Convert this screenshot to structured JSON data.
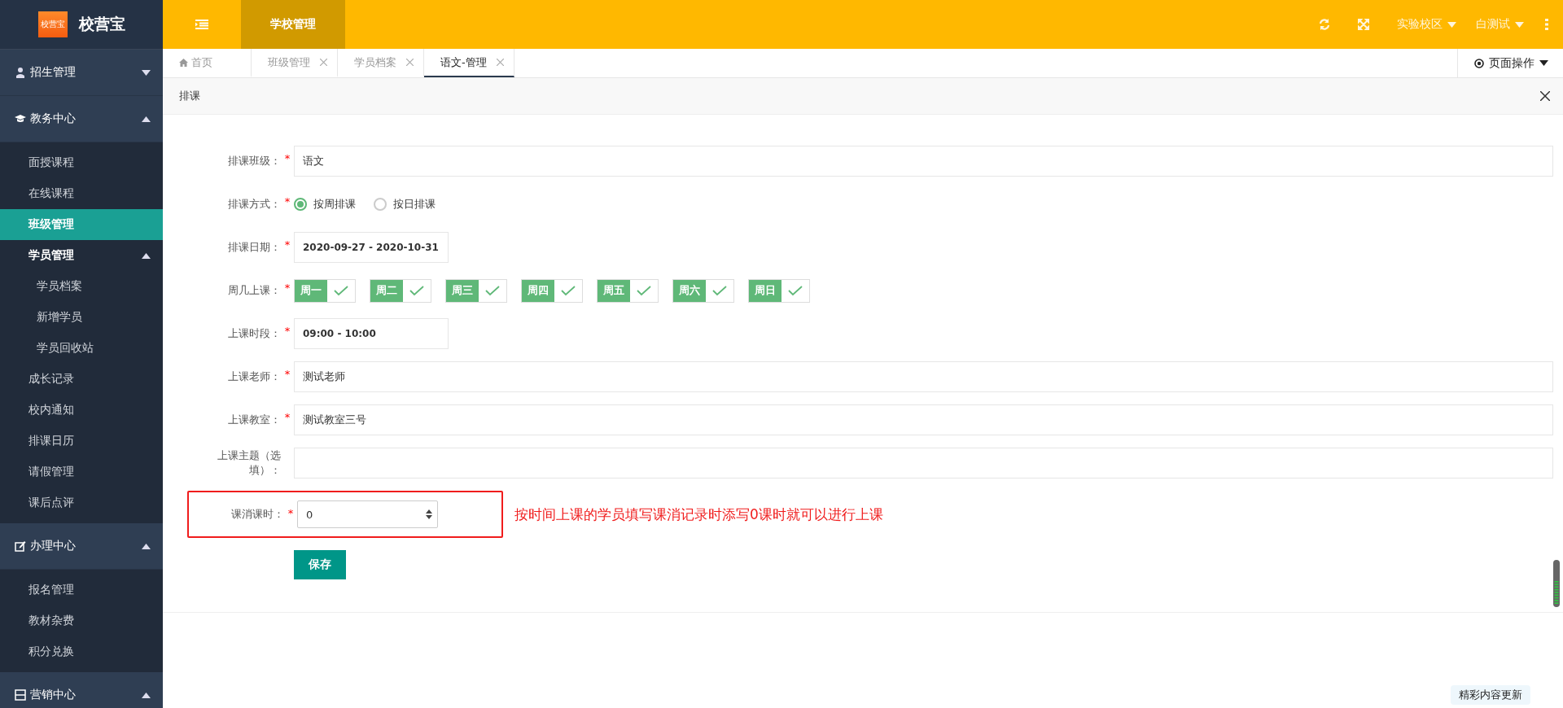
{
  "sidebar": {
    "logo_text": "校营宝",
    "brand": "校营宝",
    "groups": [
      {
        "label": "招生管理",
        "expanded": false
      },
      {
        "label": "教务中心",
        "expanded": true,
        "items": [
          {
            "label": "面授课程",
            "selected": false
          },
          {
            "label": "在线课程",
            "selected": false
          },
          {
            "label": "班级管理",
            "selected": true
          },
          {
            "label": "学员管理",
            "selected": false,
            "expanded": true,
            "children": [
              {
                "label": "学员档案",
                "selected": false
              },
              {
                "label": "新增学员",
                "selected": false
              },
              {
                "label": "学员回收站",
                "selected": false
              }
            ]
          },
          {
            "label": "成长记录",
            "selected": false
          },
          {
            "label": "校内通知",
            "selected": false
          },
          {
            "label": "排课日历",
            "selected": false
          },
          {
            "label": "请假管理",
            "selected": false
          },
          {
            "label": "课后点评",
            "selected": false
          }
        ]
      },
      {
        "label": "办理中心",
        "expanded": true,
        "items": [
          {
            "label": "报名管理",
            "selected": false
          },
          {
            "label": "教材杂费",
            "selected": false
          },
          {
            "label": "积分兑换",
            "selected": false
          }
        ]
      },
      {
        "label": "营销中心",
        "expanded": true
      }
    ]
  },
  "top_bar": {
    "nav": [
      {
        "label": "学校管理",
        "selected": true
      }
    ],
    "campus": "实验校区",
    "user": "白测试"
  },
  "tabs": [
    {
      "label": "首页",
      "kind": "home",
      "selected": false
    },
    {
      "label": "班级管理",
      "kind": "closable",
      "selected": false
    },
    {
      "label": "学员档案",
      "kind": "closable",
      "selected": false
    },
    {
      "label": "语文-管理",
      "kind": "closable",
      "selected": true
    }
  ],
  "page_actions": "页面操作",
  "panel": {
    "title": "排课",
    "fields": [
      {
        "kind": "text",
        "label": "排课班级：",
        "required_mark": "*",
        "value": "语文"
      },
      {
        "kind": "radio",
        "label": "排课方式：",
        "required_mark": "*",
        "options": [
          {
            "label": "按周排课",
            "selected": true
          },
          {
            "label": "按日排课",
            "selected": false
          }
        ]
      },
      {
        "kind": "short",
        "label": "排课日期：",
        "required_mark": "*",
        "value": "2020-09-27 - 2020-10-31"
      },
      {
        "kind": "weekdays",
        "label": "周几上课：",
        "required_mark": "*",
        "days": [
          {
            "label": "周一",
            "checked": true
          },
          {
            "label": "周二",
            "checked": true
          },
          {
            "label": "周三",
            "checked": true
          },
          {
            "label": "周四",
            "checked": true
          },
          {
            "label": "周五",
            "checked": true
          },
          {
            "label": "周六",
            "checked": true
          },
          {
            "label": "周日",
            "checked": true
          }
        ]
      },
      {
        "kind": "short",
        "label": "上课时段：",
        "required_mark": "*",
        "value": "09:00 - 10:00"
      },
      {
        "kind": "text",
        "label": "上课老师：",
        "required_mark": "*",
        "value": "测试老师"
      },
      {
        "kind": "text",
        "label": "上课教室：",
        "required_mark": "*",
        "value": "测试教室三号"
      },
      {
        "kind": "text",
        "label": "上课主题（选填）："
      },
      {
        "kind": "number",
        "label": "课消课时：",
        "required_mark": "*",
        "value": "0",
        "highlighted": true,
        "annotation": "按时间上课的学员填写课消记录时添写0课时就可以进行上课"
      }
    ],
    "save": "保存"
  },
  "float_badge": {
    "label": "精彩内容更新"
  }
}
